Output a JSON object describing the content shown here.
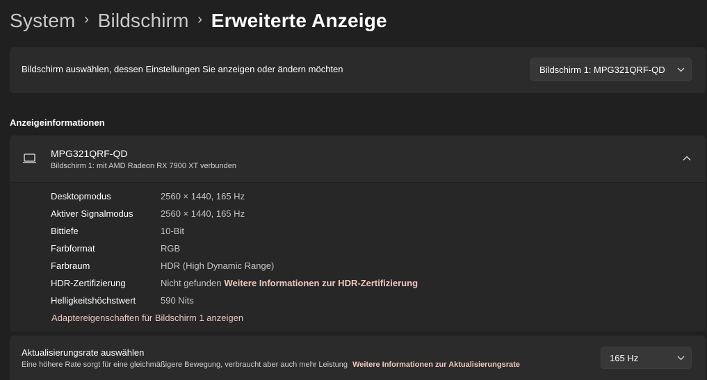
{
  "breadcrumb": {
    "items": [
      "System",
      "Bildschirm"
    ],
    "current": "Erweiterte Anzeige",
    "separator": "›"
  },
  "monitor_select": {
    "label": "Bildschirm auswählen, dessen Einstellungen Sie anzeigen oder ändern möchten",
    "selected": "Bildschirm 1: MPG321QRF-QD"
  },
  "display_info": {
    "section_title": "Anzeigeinformationen",
    "monitor_name": "MPG321QRF-QD",
    "monitor_subtitle": "Bildschirm 1: mit AMD Radeon RX 7900 XT verbunden",
    "icon": "laptop-icon",
    "properties": [
      {
        "label": "Desktopmodus",
        "value": "2560 × 1440, 165 Hz"
      },
      {
        "label": "Aktiver Signalmodus",
        "value": "2560 × 1440, 165 Hz"
      },
      {
        "label": "Bittiefe",
        "value": "10-Bit"
      },
      {
        "label": "Farbformat",
        "value": "RGB"
      },
      {
        "label": "Farbraum",
        "value": "HDR (High Dynamic Range)"
      },
      {
        "label": "HDR-Zertifizierung",
        "value": "Nicht gefunden",
        "link": "Weitere Informationen zur HDR-Zertifizierung"
      },
      {
        "label": "Helligkeitshöchstwert",
        "value": "590 Nits"
      }
    ],
    "adapter_link": "Adaptereigenschaften für Bildschirm 1 anzeigen"
  },
  "refresh_rate": {
    "title": "Aktualisierungsrate auswählen",
    "description": "Eine höhere Rate sorgt für eine gleichmäßigere Bewegung, verbraucht aber auch mehr Leistung",
    "link": "Weitere Informationen zur Aktualisierungsrate",
    "selected": "165 Hz"
  },
  "colors": {
    "background": "#202020",
    "card": "#2b2b2b",
    "accent_link": "#f0c8c0"
  }
}
